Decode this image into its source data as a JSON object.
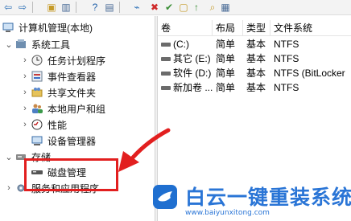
{
  "toolbar": {
    "buttons": [
      {
        "name": "back-icon",
        "glyph": "⇦",
        "color": "#2b6fb6"
      },
      {
        "name": "forward-icon",
        "glyph": "⇨",
        "color": "#2b6fb6"
      },
      {
        "name": "up-folder-icon",
        "glyph": "▣",
        "color": "#c59a27"
      },
      {
        "name": "show-hide-tree-icon",
        "glyph": "▥",
        "color": "#4d6e98"
      },
      {
        "name": "help-icon",
        "glyph": "?",
        "color": "#1f5fa8"
      },
      {
        "name": "properties-icon",
        "glyph": "▤",
        "color": "#4d6e98"
      },
      {
        "name": "connect-icon",
        "glyph": "⌁",
        "color": "#2b6fb6"
      },
      {
        "name": "delete-icon",
        "glyph": "✖",
        "color": "#cf2a2a"
      },
      {
        "name": "check-icon",
        "glyph": "✔",
        "color": "#3a8e35"
      },
      {
        "name": "folder-icon",
        "glyph": "▢",
        "color": "#c59a27"
      },
      {
        "name": "move-up-icon",
        "glyph": "↑",
        "color": "#3a8e35"
      },
      {
        "name": "search-folder-icon",
        "glyph": "⌕",
        "color": "#c59a27"
      },
      {
        "name": "view-list-icon",
        "glyph": "▦",
        "color": "#4d6e98"
      }
    ]
  },
  "tree": {
    "root": "计算机管理(本地)",
    "system_tools": "系统工具",
    "task_scheduler": "任务计划程序",
    "event_viewer": "事件查看器",
    "shared_folders": "共享文件夹",
    "local_users": "本地用户和组",
    "performance": "性能",
    "device_manager": "设备管理器",
    "storage": "存储",
    "disk_management": "磁盘管理",
    "services_apps": "服务和应用程序"
  },
  "list": {
    "columns": [
      "卷",
      "布局",
      "类型",
      "文件系统"
    ],
    "rows": [
      {
        "volume": "(C:)",
        "layout": "简单",
        "type": "基本",
        "fs": "NTFS"
      },
      {
        "volume": "其它 (E:)",
        "layout": "简单",
        "type": "基本",
        "fs": "NTFS"
      },
      {
        "volume": "软件 (D:)",
        "layout": "简单",
        "type": "基本",
        "fs": "NTFS (BitLocker"
      },
      {
        "volume": "新加卷 ...",
        "layout": "简单",
        "type": "基本",
        "fs": "NTFS"
      }
    ]
  },
  "colors": {
    "highlight": "#e21f1f",
    "watermark": "#2a75d6"
  },
  "watermark": {
    "title": "白云一键重装系统",
    "url": "www.baiyunxitong.com"
  }
}
